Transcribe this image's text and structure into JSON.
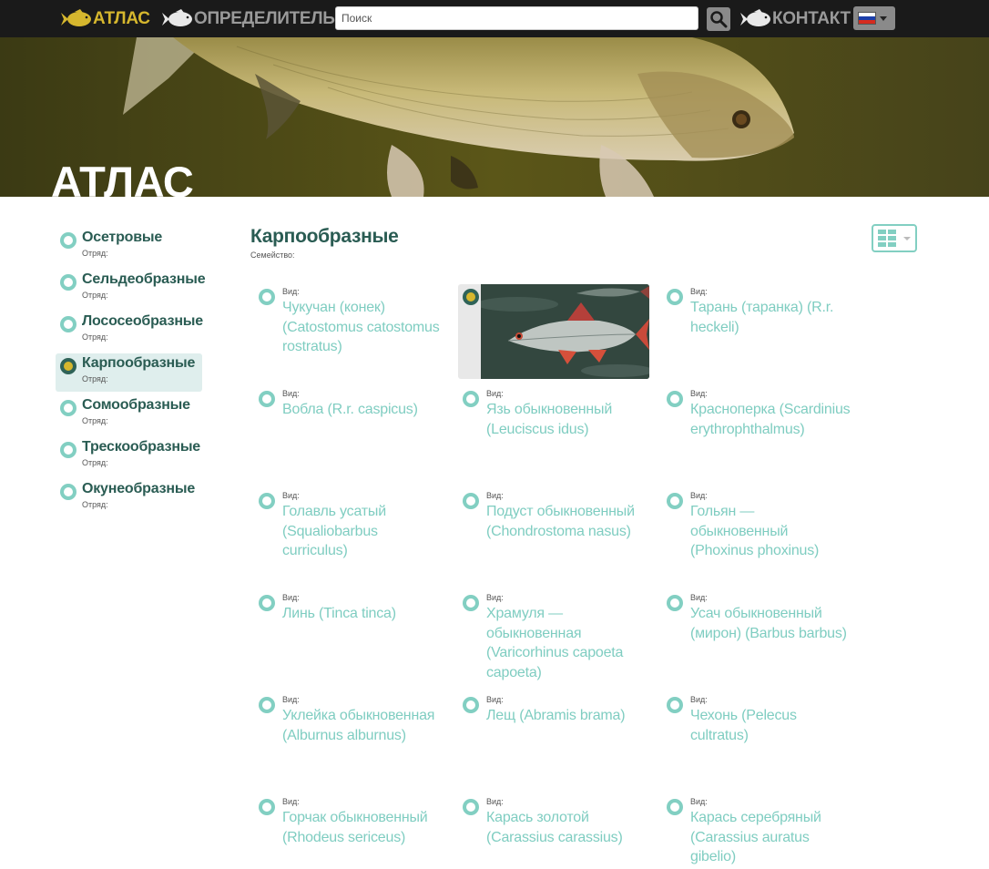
{
  "nav": {
    "atlas_label": "АТЛАС",
    "identifier_label": "ОПРЕДЕЛИТЕЛЬ",
    "contact_label": "КОНТАКТ",
    "search_placeholder": "Поиск",
    "language": "ru"
  },
  "colors": {
    "topbar_bg": "#1a1a1a",
    "accent_gold": "#d6b72e",
    "nav_gray": "#9a9a9a",
    "teal_light": "#82cfc2",
    "teal_dark": "#2a5c53",
    "active_bg": "#dfeeed"
  },
  "hero": {
    "title": "АТЛАС"
  },
  "sidebar": {
    "items": [
      {
        "name": "Осетровые",
        "sub": "Отряд:",
        "active": false
      },
      {
        "name": "Сельдеобразные",
        "sub": "Отряд:",
        "active": false
      },
      {
        "name": "Лососеобразные",
        "sub": "Отряд:",
        "active": false
      },
      {
        "name": "Карпообразные",
        "sub": "Отряд:",
        "active": true
      },
      {
        "name": "Сомообразные",
        "sub": "Отряд:",
        "active": false
      },
      {
        "name": "Трескообразные",
        "sub": "Отряд:",
        "active": false
      },
      {
        "name": "Окунеобразные",
        "sub": "Отряд:",
        "active": false
      }
    ]
  },
  "content": {
    "title": "Карпообразные",
    "subtitle": "Семейство:",
    "species": [
      {
        "kind": "Вид:",
        "name": "Чукучан (конек) (Catostomus catostomus rostratus)"
      },
      {
        "kind": "Вид:",
        "name": "",
        "image": "roach-fish-photo"
      },
      {
        "kind": "Вид:",
        "name": "Тарань (таранка) (R.r. heckeli)"
      },
      {
        "kind": "Вид:",
        "name": "Вобла (R.r. caspicus)"
      },
      {
        "kind": "Вид:",
        "name": "Язь обыкновенный (Leuciscus idus)"
      },
      {
        "kind": "Вид:",
        "name": "Красноперка (Scardinius erythrophthalmus)"
      },
      {
        "kind": "Вид:",
        "name": "Голавль усатый (Squaliobarbus curriculus)"
      },
      {
        "kind": "Вид:",
        "name": "Подуст обыкновенный (Chondrostoma nasus)"
      },
      {
        "kind": "Вид:",
        "name": "Гольян — обыкновенный (Phoxinus phoxinus)"
      },
      {
        "kind": "Вид:",
        "name": "Линь (Tinca tinca)"
      },
      {
        "kind": "Вид:",
        "name": "Храмуля — обыкновенная (Varicorhinus capoeta capoeta)"
      },
      {
        "kind": "Вид:",
        "name": "Усач обыкновенный (мирон) (Barbus barbus)"
      },
      {
        "kind": "Вид:",
        "name": "Уклейка обыкновенная (Alburnus alburnus)"
      },
      {
        "kind": "Вид:",
        "name": "Лещ (Abramis brama)"
      },
      {
        "kind": "Вид:",
        "name": "Чехонь (Pelecus cultratus)"
      },
      {
        "kind": "Вид:",
        "name": "Горчак обыкновенный (Rhodeus sericeus)"
      },
      {
        "kind": "Вид:",
        "name": "Карась золотой (Carassius carassius)"
      },
      {
        "kind": "Вид:",
        "name": "Карась серебряный (Carassius auratus gibelio)"
      }
    ]
  }
}
